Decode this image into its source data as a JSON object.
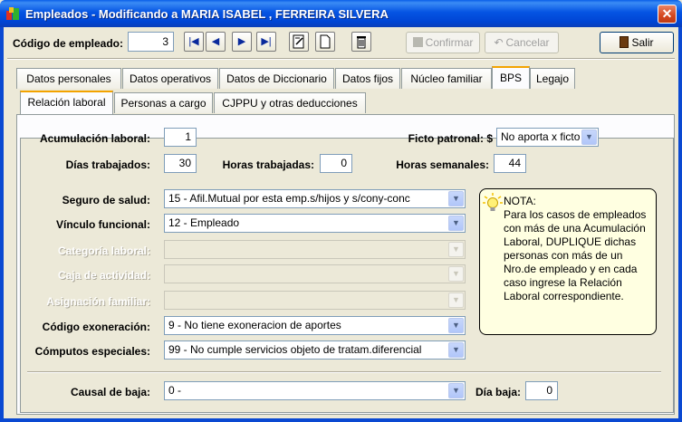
{
  "window": {
    "title": "Empleados - Modificando a MARIA ISABEL , FERREIRA SILVERA",
    "close_glyph": "✕"
  },
  "toolbar": {
    "code_label": "Código de empleado:",
    "code_value": "3",
    "nav_first": "|◀",
    "nav_prev": "◀",
    "nav_next": "▶",
    "nav_last": "▶|",
    "confirm_label": "Confirmar",
    "cancel_label": "Cancelar",
    "exit_label": "Salir"
  },
  "tabs": [
    "Datos personales",
    "Datos operativos",
    "Datos de Diccionario",
    "Datos fijos",
    "Núcleo familiar",
    "BPS",
    "Legajo"
  ],
  "subtabs": [
    "Relación laboral",
    "Personas a cargo",
    "CJPPU y otras deducciones"
  ],
  "form": {
    "acumulacion_label": "Acumulación laboral:",
    "acumulacion_value": "1",
    "ficto_label": "Ficto patronal: $",
    "ficto_value": "No aporta x ficto",
    "dias_label": "Días trabajados:",
    "dias_value": "30",
    "horas_trab_label": "Horas trabajadas:",
    "horas_trab_value": "0",
    "horas_sem_label": "Horas semanales:",
    "horas_sem_value": "44",
    "seguro_label": "Seguro de salud:",
    "seguro_value": "15 - Afil.Mutual por esta emp.s/hijos y s/cony-conc",
    "vinculo_label": "Vínculo funcional:",
    "vinculo_value": "12 - Empleado",
    "categoria_label": "Categoría laboral:",
    "categoria_value": "",
    "caja_label": "Caja de actividad:",
    "caja_value": "",
    "asignacion_label": "Asignación familiar:",
    "asignacion_value": "",
    "exoneracion_label": "Código exoneración:",
    "exoneracion_value": "9 - No tiene exoneracion de aportes",
    "computos_label": "Cómputos especiales:",
    "computos_value": "99 - No cumple servicios objeto de tratam.diferencial",
    "causal_label": "Causal de baja:",
    "causal_value": "0 -",
    "dia_baja_label": "Día baja:",
    "dia_baja_value": "0"
  },
  "note": {
    "text": "NOTA:\nPara los casos de empleados con más de una Acumulación Laboral, DUPLIQUE dichas personas con más de un Nro.de empleado y en cada caso ingrese la Relación Laboral correspondiente."
  }
}
